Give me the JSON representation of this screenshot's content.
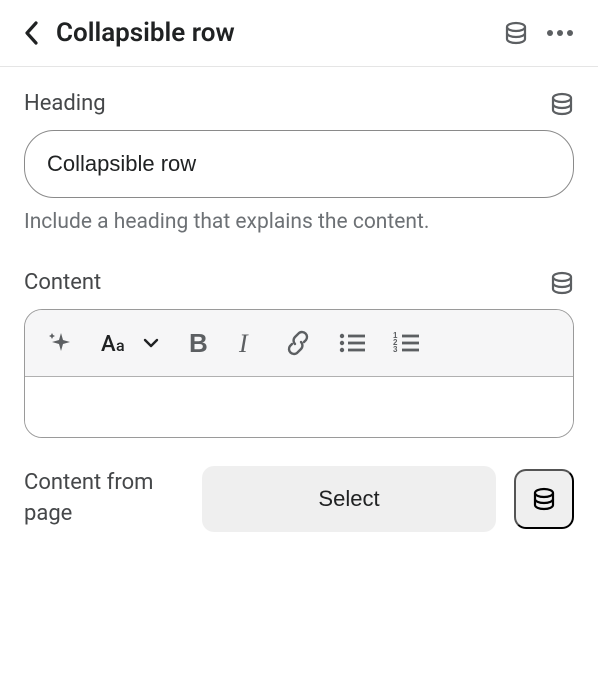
{
  "header": {
    "title": "Collapsible row"
  },
  "heading": {
    "label": "Heading",
    "value": "Collapsible row",
    "help": "Include a heading that explains the content."
  },
  "content": {
    "label": "Content",
    "value": ""
  },
  "contentFromPage": {
    "label": "Content from page",
    "selectLabel": "Select"
  }
}
